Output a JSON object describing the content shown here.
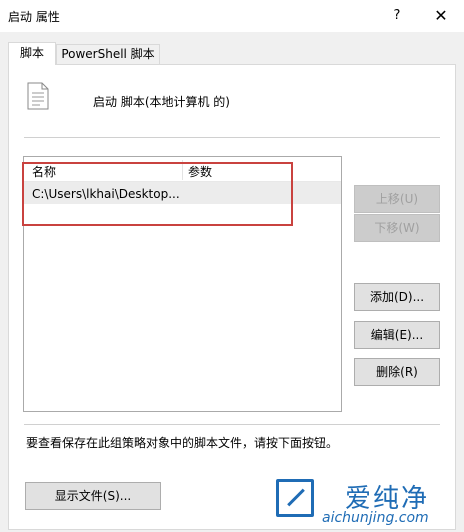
{
  "window": {
    "title": "启动 属性",
    "help_glyph": "?",
    "close_glyph": "✕"
  },
  "tabs": [
    {
      "label": "脚本",
      "selected": true
    },
    {
      "label": "PowerShell 脚本",
      "selected": false
    }
  ],
  "header": {
    "text": "启动 脚本(本地计算机 的)",
    "icon": "script-document-icon"
  },
  "list": {
    "columns": [
      "名称",
      "参数"
    ],
    "rows": [
      {
        "name": "C:\\Users\\lkhai\\Desktop...",
        "params": ""
      }
    ]
  },
  "buttons": {
    "up": "上移(U)",
    "down": "下移(W)",
    "add": "添加(D)...",
    "edit": "编辑(E)...",
    "remove": "删除(R)",
    "show_files": "显示文件(S)..."
  },
  "info_text": "要查看保存在此组策略对象中的脚本文件，请按下面按钮。",
  "watermark": {
    "logo_text": "爱纯净",
    "url": "aichunjing.com",
    "color": "#1f6cb5"
  },
  "colors": {
    "highlight": "#c9423f"
  }
}
